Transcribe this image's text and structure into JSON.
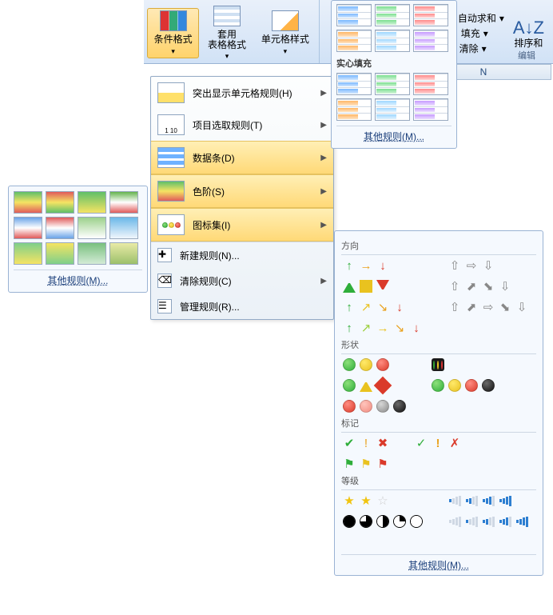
{
  "ribbon": {
    "conditional_formatting": "条件格式",
    "format_table": "套用\n表格格式",
    "cell_styles": "单元格样式",
    "autosum": "自动求和",
    "fill": "填充",
    "clear": "清除",
    "sort_filter": "排序和",
    "editing_group": "编辑"
  },
  "column_header": "N",
  "grad_gallery": {
    "solid_header": "实心填充",
    "more_rules": "其他规则(M)..."
  },
  "cf_menu": {
    "highlight": "突出显示单元格规则(H)",
    "top_bottom": "项目选取规则(T)",
    "data_bars": "数据条(D)",
    "color_scales": "色阶(S)",
    "icon_sets": "图标集(I)",
    "new_rule": "新建规则(N)...",
    "clear_rules": "清除规则(C)",
    "manage_rules": "管理规则(R)..."
  },
  "scale_gallery": {
    "more_rules": "其他规则(M)..."
  },
  "iconset": {
    "direction": "方向",
    "shapes": "形状",
    "indicators": "标记",
    "ratings": "等级",
    "more_rules": "其他规则(M)..."
  }
}
